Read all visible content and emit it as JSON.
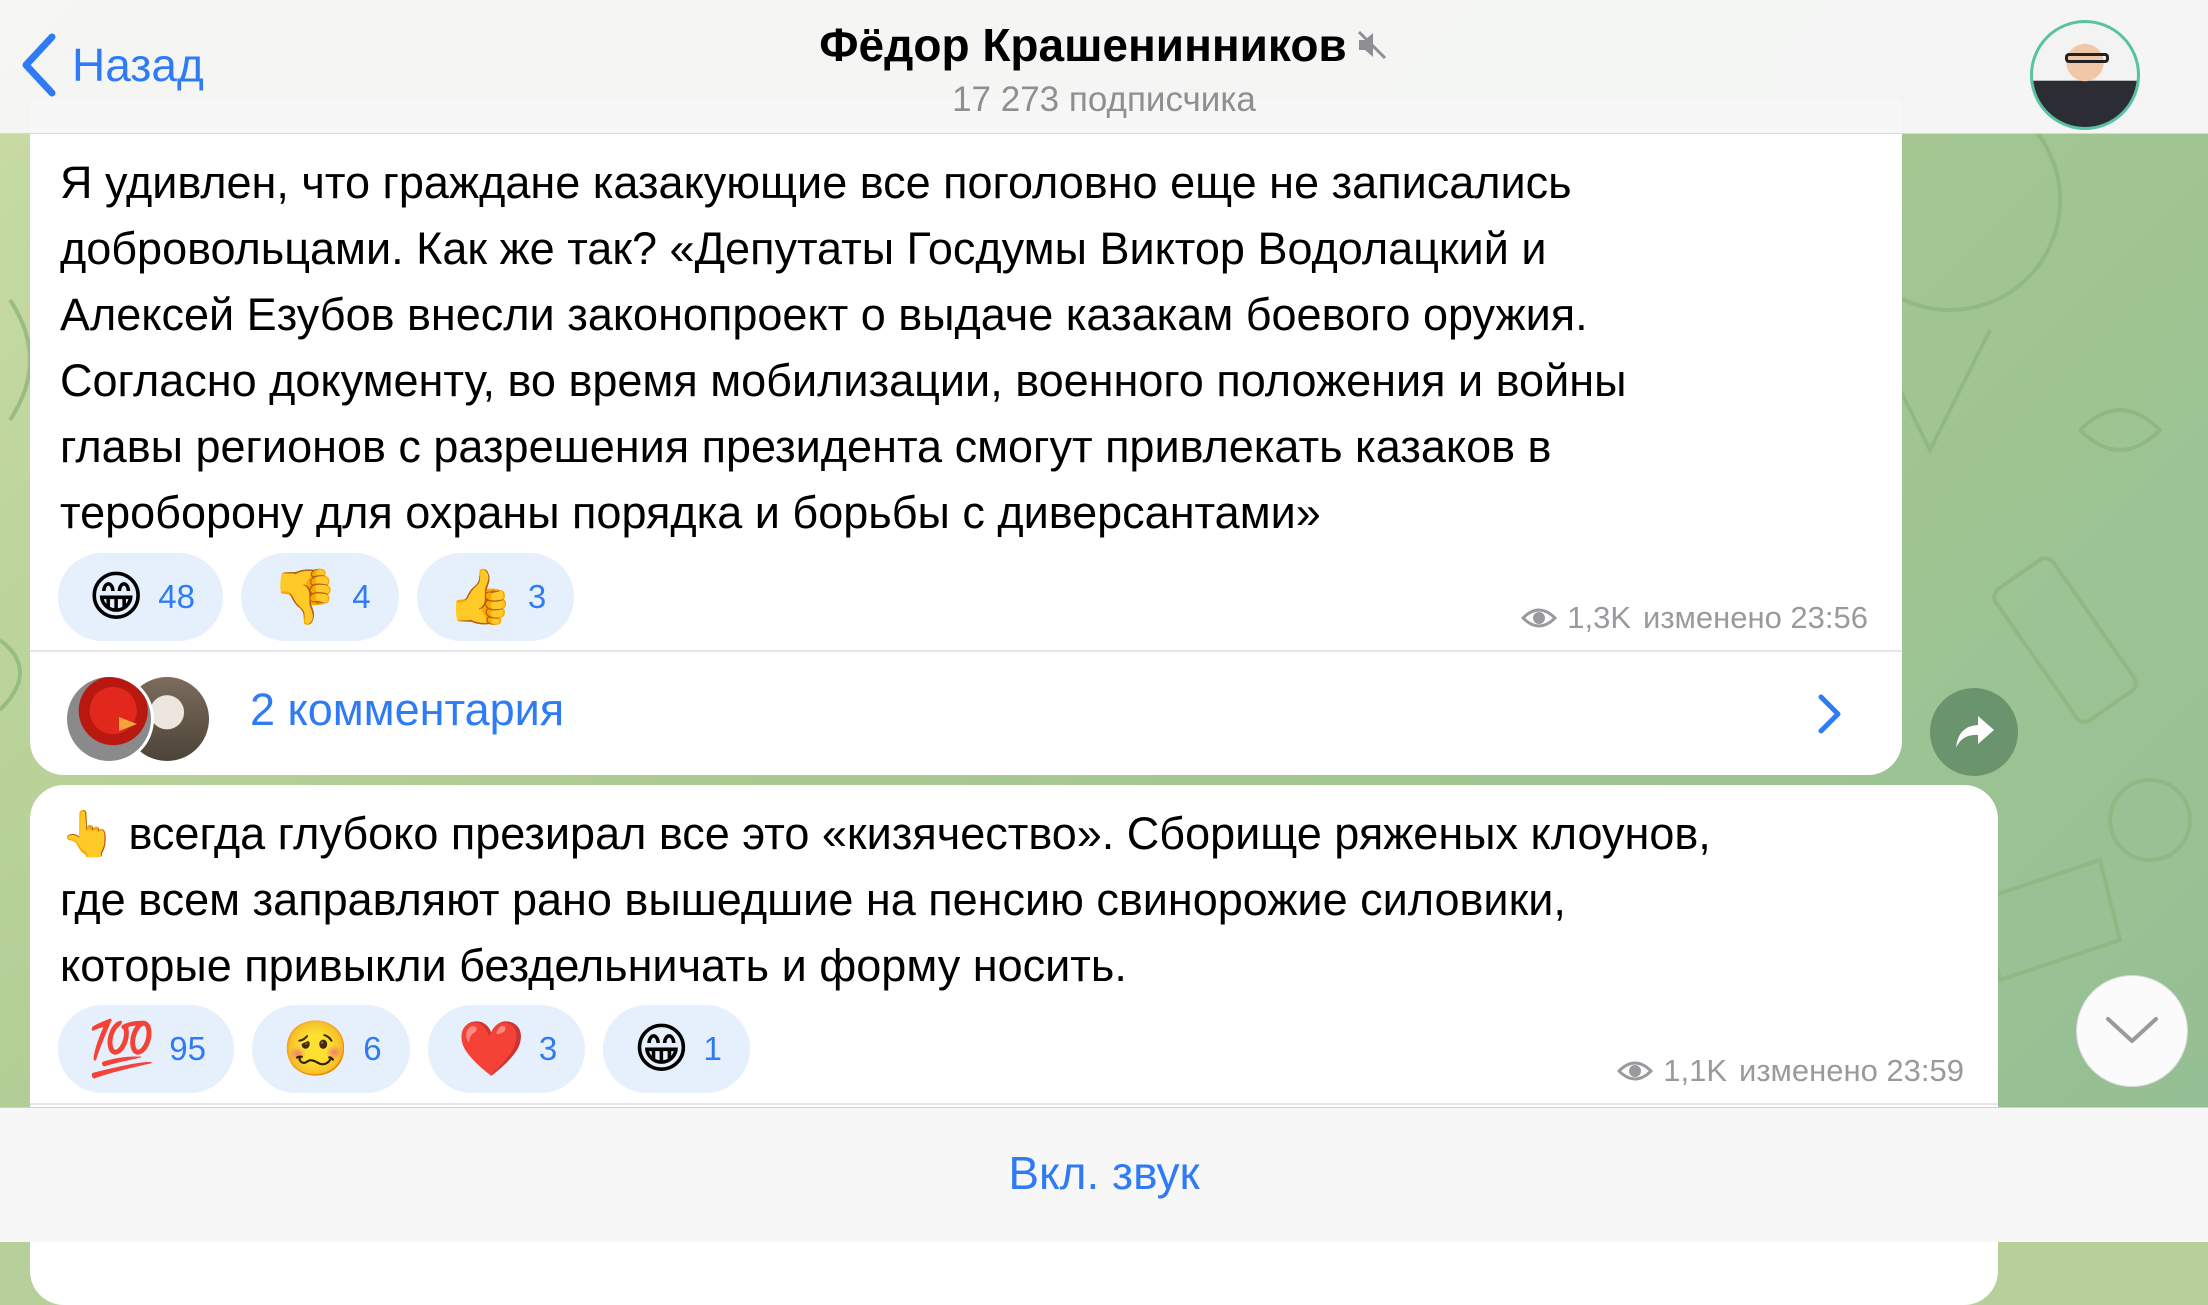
{
  "header": {
    "back_label": "Назад",
    "channel_title": "Фёдор Крашенинников",
    "subscribers": "17 273 подписчика",
    "mute_icon": "speaker-muted-icon"
  },
  "messages": [
    {
      "text": "Я удивлен, что граждане казакующие все поголовно еще не записались\nдобровольцами. Как же так? «Депутаты Госдумы Виктор Водолацкий и\nАлексей Езубов внесли законопроект о выдаче казакам боевого оружия.\nСогласно документу, во время мобилизации, военного положения и войны\nглавы регионов с разрешения президента смогут привлекать казаков в\nтероборону для охраны порядка и борьбы с диверсантами»",
      "reactions": [
        {
          "emoji": "😁",
          "count": "48"
        },
        {
          "emoji": "👎",
          "count": "4"
        },
        {
          "emoji": "👍",
          "count": "3"
        }
      ],
      "views": "1,3K",
      "edited_time": "изменено 23:56",
      "comments_label": "2 комментария"
    },
    {
      "text": "👆 всегда глубоко презирал все это «кизячество». Сборище ряженых клоунов,\nгде всем заправляют рано вышедшие на пенсию свинорожие силовики,\nкоторые привыкли бездельничать и форму носить.",
      "reactions": [
        {
          "emoji": "💯",
          "count": "95"
        },
        {
          "emoji": "🥴",
          "count": "6"
        },
        {
          "emoji": "❤️",
          "count": "3"
        },
        {
          "emoji": "😁",
          "count": "1"
        }
      ],
      "views": "1,1K",
      "edited_time": "изменено 23:59"
    }
  ],
  "bottom": {
    "unmute_label": "Вкл. звук"
  },
  "colors": {
    "accent": "#2f7bf6",
    "reaction_bg": "#e6f0fd",
    "meta_gray": "#9a9a9e"
  }
}
